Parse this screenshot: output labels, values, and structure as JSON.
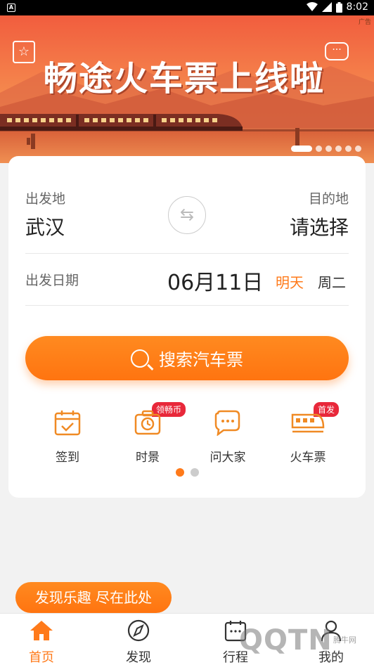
{
  "status_bar": {
    "time": "8:02"
  },
  "banner": {
    "ad_label": "广告",
    "headline": "畅途火车票上线啦",
    "slide_count": 6,
    "active_slide": 1
  },
  "route": {
    "departure_label": "出发地",
    "departure_value": "武汉",
    "destination_label": "目的地",
    "destination_value": "请选择",
    "swap_icon": "swap-arrows-icon"
  },
  "date": {
    "label": "出发日期",
    "value": "06月11日",
    "relative": "明天",
    "weekday": "周二"
  },
  "search_button": {
    "label": "搜索汽车票",
    "icon": "search-icon"
  },
  "quick_entries": [
    {
      "label": "签到",
      "icon": "calendar-check-icon",
      "badge": ""
    },
    {
      "label": "时景",
      "icon": "camera-clock-icon",
      "badge": "领畅币"
    },
    {
      "label": "问大家",
      "icon": "chat-bubbles-icon",
      "badge": ""
    },
    {
      "label": "火车票",
      "icon": "train-icon",
      "badge": "首发"
    }
  ],
  "quick_pager": {
    "pages": 2,
    "active": 1
  },
  "discover_pill": "发现乐趣 尽在此处",
  "tabs": [
    {
      "label": "首页",
      "icon": "home-icon",
      "active": true
    },
    {
      "label": "发现",
      "icon": "compass-icon",
      "active": false
    },
    {
      "label": "行程",
      "icon": "calendar-icon",
      "active": false
    },
    {
      "label": "我的",
      "icon": "user-icon",
      "active": false
    }
  ],
  "watermark": {
    "text": "QQTN",
    "small": "腾牛网"
  },
  "colors": {
    "accent": "#ff7a1a",
    "badge": "#e8283a",
    "banner_top": "#f26a43",
    "banner_bottom": "#f8a25e"
  }
}
